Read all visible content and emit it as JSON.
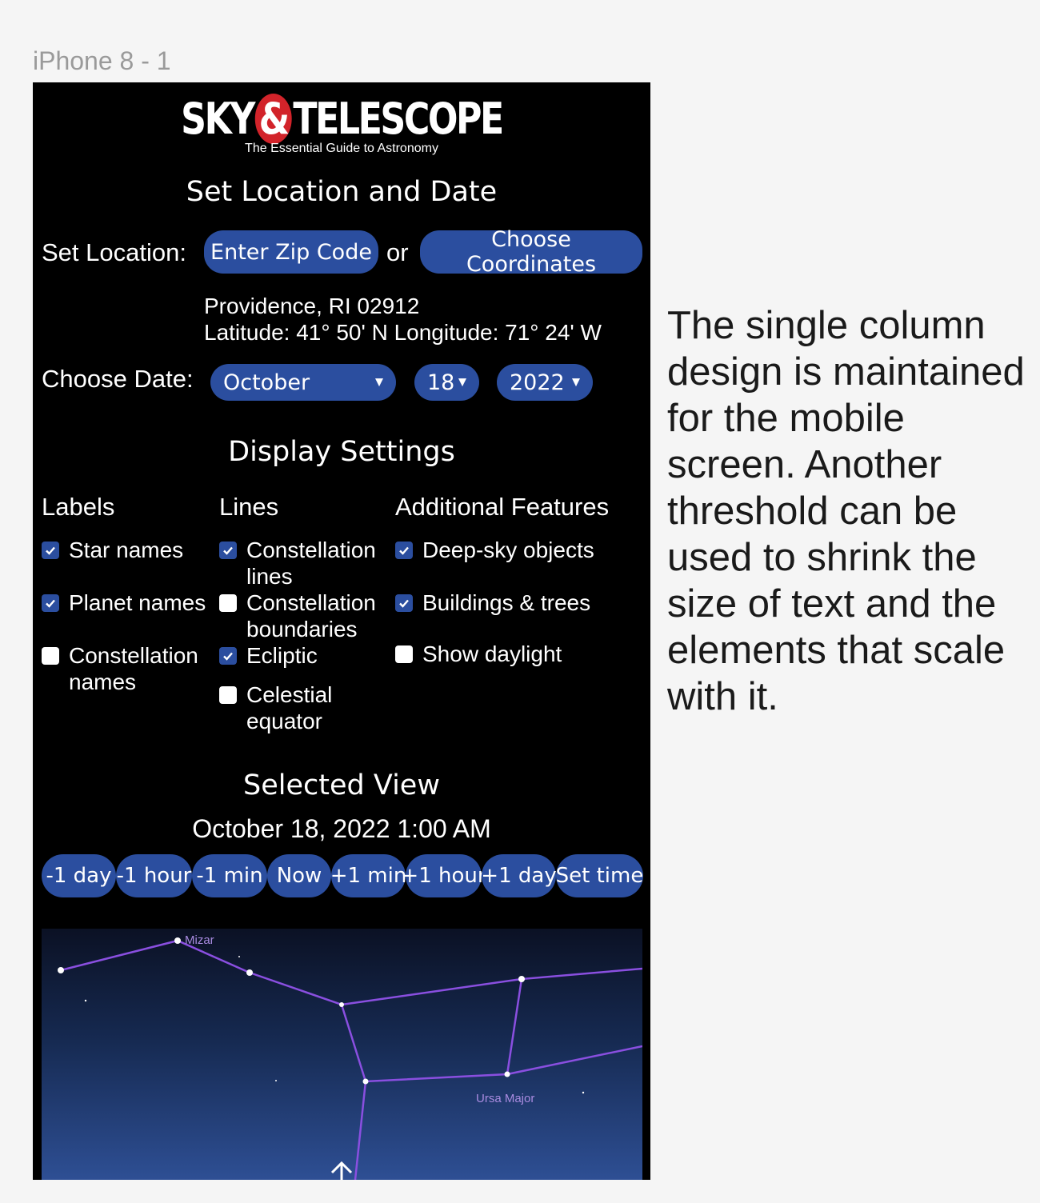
{
  "frame_label": "iPhone 8 - 1",
  "header": {
    "brand_left": "SKY",
    "brand_amp": "&",
    "brand_right": "TELESCOPE",
    "tagline": "The Essential Guide to Astronomy"
  },
  "location": {
    "title": "Set Location and Date",
    "set_location_label": "Set Location:",
    "zip_button": "Enter Zip Code",
    "or_text": "or",
    "coords_button": "Choose Coordinates",
    "place": "Providence, RI 02912",
    "latlon": "Latitude: 41° 50' N Longitude: 71° 24' W",
    "choose_date_label": "Choose Date:",
    "month": "October",
    "day": "18",
    "year": "2022"
  },
  "display": {
    "title": "Display Settings",
    "columns": {
      "labels": {
        "heading": "Labels",
        "items": [
          {
            "label": "Star names",
            "checked": true
          },
          {
            "label": "Planet names",
            "checked": true
          },
          {
            "label": "Constellation names",
            "checked": false
          }
        ]
      },
      "lines": {
        "heading": "Lines",
        "items": [
          {
            "label": "Constellation lines",
            "checked": true
          },
          {
            "label": "Constellation boundaries",
            "checked": false
          },
          {
            "label": "Ecliptic",
            "checked": true
          },
          {
            "label": "Celestial equator",
            "checked": false
          }
        ]
      },
      "features": {
        "heading": "Additional Features",
        "items": [
          {
            "label": "Deep-sky objects",
            "checked": true
          },
          {
            "label": "Buildings & trees",
            "checked": true
          },
          {
            "label": "Show daylight",
            "checked": false
          }
        ]
      }
    }
  },
  "view": {
    "title": "Selected View",
    "datetime": "October 18, 2022 1:00 AM",
    "buttons": [
      "-1 day",
      "-1 hour",
      "-1 min",
      "Now",
      "+1 min",
      "+1 hour",
      "+1 day",
      "Set time"
    ]
  },
  "sky_map": {
    "star_label": "Mizar",
    "constellation_label": "Ursa Major",
    "line_color": "#8a4fe0",
    "label_color": "#a98be0"
  },
  "side_note": "The single column design is maintained for the mobile screen. Another threshold can be used to shrink the size of text and the elements that scale with it.",
  "colors": {
    "accent": "#2b4e9f",
    "phone_bg": "#000000",
    "page_bg": "#f5f5f5"
  }
}
